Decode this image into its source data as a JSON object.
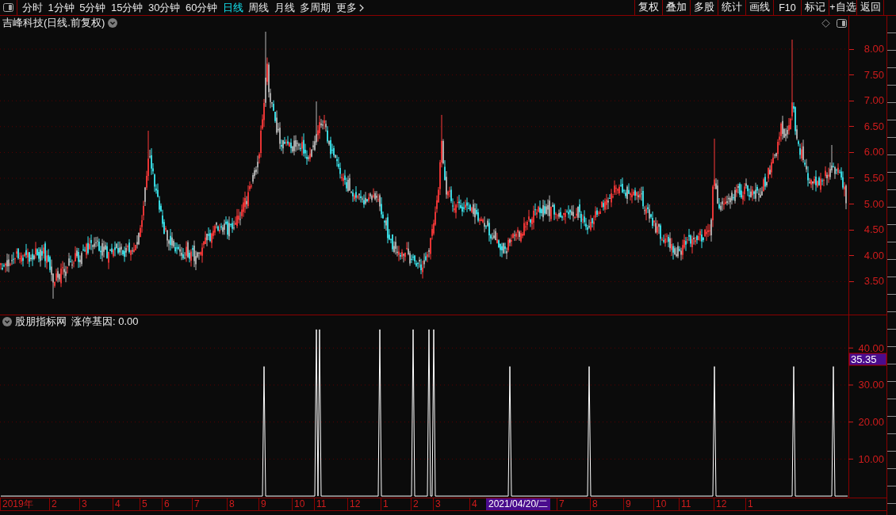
{
  "toolbar": {
    "period_tabs": [
      {
        "label": "分时",
        "selected": false
      },
      {
        "label": "1分钟",
        "selected": false
      },
      {
        "label": "5分钟",
        "selected": false
      },
      {
        "label": "15分钟",
        "selected": false
      },
      {
        "label": "30分钟",
        "selected": false
      },
      {
        "label": "60分钟",
        "selected": false
      },
      {
        "label": "日线",
        "selected": true
      },
      {
        "label": "周线",
        "selected": false
      },
      {
        "label": "月线",
        "selected": false
      },
      {
        "label": "多周期",
        "selected": false
      }
    ],
    "more_button": {
      "label": "更多"
    },
    "buttons": [
      "复权",
      "叠加",
      "多股",
      "统计",
      "画线",
      "F10",
      "标记",
      "+自选",
      "返回"
    ]
  },
  "price_panel": {
    "title": "吉峰科技(日线.前复权)",
    "price_axis": [
      "8.00",
      "7.50",
      "7.00",
      "6.50",
      "6.00",
      "5.50",
      "5.00",
      "4.50",
      "4.00",
      "3.50"
    ]
  },
  "indicator_panel": {
    "name": "股朋指标网",
    "output": "涨停基因: 0.00",
    "cursor_value": "35.35",
    "chart_data": {
      "type": "line",
      "categories": [
        null,
        null,
        null,
        null,
        null,
        null,
        null,
        null,
        null,
        null,
        null,
        null,
        null,
        null,
        null,
        null,
        null,
        null,
        null,
        null,
        null,
        null,
        null,
        null,
        null,
        null,
        null,
        null,
        null,
        null,
        null,
        null,
        null,
        null,
        null,
        null,
        null,
        null,
        null,
        null,
        null,
        null,
        null,
        null,
        null,
        null,
        null,
        null,
        null,
        null,
        null,
        null,
        null,
        null,
        null,
        null,
        null,
        null,
        null,
        null,
        null,
        null,
        null,
        null,
        null,
        null,
        null,
        null,
        null,
        null,
        null,
        null,
        null,
        null,
        null,
        null,
        null,
        null,
        null,
        null,
        null,
        null,
        null,
        null,
        null,
        null,
        null,
        null,
        null,
        null,
        null,
        null,
        null,
        null,
        null,
        null,
        null,
        null,
        null,
        null,
        null,
        null,
        null,
        null,
        null,
        null,
        null,
        null,
        null,
        null,
        null,
        null,
        null,
        null,
        null,
        null,
        null,
        null,
        null,
        null,
        null,
        null,
        null,
        null,
        null,
        null,
        null,
        null,
        null,
        null,
        null,
        null,
        null,
        null,
        null,
        null,
        null,
        null,
        null,
        null,
        null,
        null,
        null,
        null,
        null,
        null,
        null,
        null,
        null,
        null,
        null,
        null,
        null,
        null,
        null,
        null,
        null,
        null,
        null,
        null,
        null,
        null,
        null,
        null,
        null,
        null,
        null,
        null,
        null,
        null,
        null,
        null,
        null,
        null,
        null,
        null,
        null,
        null,
        null,
        null,
        null,
        null,
        null,
        null,
        null,
        null,
        null,
        null,
        null,
        null,
        null,
        null,
        null,
        null,
        null,
        null,
        null,
        null,
        null,
        null,
        null,
        null,
        null,
        null,
        null,
        null,
        null,
        null,
        null,
        null,
        null,
        null,
        null,
        null,
        null,
        null,
        null,
        null,
        null,
        null,
        null,
        null,
        null,
        null,
        null,
        null,
        null,
        null,
        null,
        null,
        null,
        null,
        null,
        null,
        null,
        null,
        null,
        null,
        null,
        null,
        null,
        null,
        null,
        null,
        null,
        null,
        null,
        null,
        null,
        null,
        null,
        null,
        null,
        null,
        null,
        null,
        null,
        null,
        null,
        null,
        null,
        null,
        null,
        null,
        null,
        null,
        null,
        null,
        null,
        null,
        null,
        null,
        null,
        null,
        null,
        null,
        null,
        null,
        null,
        null,
        null,
        null,
        null,
        null,
        null,
        null,
        null,
        null,
        null,
        null,
        null,
        null,
        null,
        null,
        null,
        null,
        null,
        null,
        null,
        null,
        null,
        null,
        null,
        null,
        null,
        null,
        null,
        null,
        null,
        null,
        null,
        null,
        null,
        null,
        null,
        null,
        null,
        null,
        null,
        null,
        null,
        null,
        null,
        null,
        null,
        null,
        null,
        null,
        null,
        null,
        null,
        null,
        null,
        null,
        null,
        null,
        null,
        null,
        null,
        null,
        null,
        null,
        null,
        null,
        null,
        null,
        null,
        null,
        null,
        null,
        null,
        null,
        null,
        null,
        null,
        null,
        null,
        null,
        null,
        null,
        null,
        null,
        null,
        null,
        null,
        null,
        null,
        null,
        null,
        null,
        null,
        null,
        null,
        null,
        null,
        null,
        null,
        null,
        null,
        null,
        null,
        null,
        null,
        null,
        null,
        null,
        null,
        null,
        null,
        null,
        null,
        null,
        null,
        null,
        null,
        null,
        null,
        null,
        null,
        null,
        null,
        null,
        null,
        null,
        null,
        null,
        null,
        null,
        null,
        null,
        null,
        null,
        null,
        null,
        null,
        null,
        null,
        null,
        null,
        null,
        null,
        null,
        null,
        null,
        null,
        null,
        null,
        null,
        null,
        null,
        null,
        null,
        null,
        null,
        null,
        null,
        null,
        null,
        null,
        null,
        null,
        null,
        null,
        null,
        null,
        null,
        null,
        null,
        null,
        null,
        null,
        null,
        null,
        null,
        null,
        null,
        null,
        null,
        null,
        null,
        null,
        null,
        null,
        null,
        null,
        null,
        null,
        null,
        null,
        null,
        null,
        null,
        null,
        null,
        null,
        null,
        null,
        null,
        null,
        null,
        null,
        null,
        null,
        null,
        null,
        null,
        null,
        null,
        null,
        null,
        null,
        null,
        null,
        null,
        null,
        null,
        null,
        null,
        null,
        null,
        null,
        null,
        null,
        null,
        null,
        null,
        null,
        null,
        null,
        null,
        null,
        null,
        null,
        null,
        null,
        null,
        null,
        null,
        null,
        null,
        null,
        null,
        null,
        null,
        null,
        null,
        null,
        null,
        null,
        null,
        null,
        null,
        null,
        null,
        null
      ],
      "series": [
        {
          "color": "#ffffff",
          "values": [
            0,
            0,
            0,
            0,
            0,
            0,
            0,
            0,
            0,
            0,
            0,
            0,
            0,
            0,
            0,
            0,
            0,
            0,
            0,
            0,
            0,
            0,
            0,
            0,
            0,
            0,
            0,
            0,
            0,
            0,
            0,
            0,
            0,
            0,
            0,
            0,
            0,
            0,
            0,
            0,
            0,
            0,
            0,
            0,
            0,
            0,
            0,
            0,
            0,
            0,
            0,
            0,
            0,
            0,
            0,
            0,
            0,
            0,
            0,
            0,
            0,
            0,
            0,
            0,
            0,
            0,
            0,
            0,
            0,
            0,
            0,
            0,
            0,
            0,
            0,
            0,
            0,
            0,
            0,
            0,
            0,
            0,
            0,
            0,
            0,
            0,
            0,
            0,
            0,
            0,
            0,
            0,
            0,
            0,
            0,
            0,
            0,
            0,
            0,
            0,
            0,
            0,
            0,
            0,
            0,
            0,
            0,
            0,
            0,
            0,
            0,
            0,
            0,
            0,
            0,
            0,
            0,
            0,
            0,
            0,
            0,
            0,
            0,
            0,
            0,
            0,
            0,
            0,
            0,
            0,
            0,
            0,
            0,
            0,
            0,
            0,
            0,
            0,
            0,
            0,
            0,
            0,
            0,
            0,
            0,
            0,
            0,
            0,
            0,
            0,
            0,
            0,
            0,
            0,
            0,
            0,
            0,
            0,
            0,
            0,
            0,
            0,
            0,
            0,
            0,
            0,
            35,
            0,
            0,
            0,
            0,
            0,
            0,
            0,
            0,
            0,
            0,
            0,
            0,
            0,
            0,
            0,
            0,
            0,
            0,
            0,
            0,
            0,
            0,
            0,
            0,
            0,
            0,
            0,
            0,
            0,
            0,
            0,
            0,
            45,
            0,
            45,
            0,
            0,
            0,
            0,
            0,
            0,
            0,
            0,
            0,
            0,
            0,
            0,
            0,
            0,
            0,
            0,
            0,
            0,
            0,
            0,
            0,
            0,
            0,
            0,
            0,
            0,
            0,
            0,
            0,
            0,
            0,
            0,
            0,
            0,
            0,
            0,
            0,
            45,
            0,
            0,
            0,
            0,
            0,
            0,
            0,
            0,
            0,
            0,
            0,
            0,
            0,
            0,
            0,
            0,
            0,
            0,
            0,
            0,
            45,
            0,
            0,
            0,
            0,
            0,
            0,
            0,
            0,
            0,
            45,
            0,
            0,
            45,
            0,
            0,
            0,
            0,
            0,
            0,
            0,
            0,
            0,
            0,
            0,
            0,
            0,
            0,
            0,
            0,
            0,
            0,
            0,
            0,
            0,
            0,
            0,
            0,
            0,
            0,
            0,
            0,
            0,
            0,
            0,
            0,
            0,
            0,
            0,
            0,
            0,
            0,
            0,
            0,
            0,
            0,
            0,
            0,
            0,
            0,
            0,
            35,
            0,
            0,
            0,
            0,
            0,
            0,
            0,
            0,
            0,
            0,
            0,
            0,
            0,
            0,
            0,
            0,
            0,
            0,
            0,
            0,
            0,
            0,
            0,
            0,
            0,
            0,
            0,
            0,
            0,
            0,
            0,
            0,
            0,
            0,
            0,
            0,
            0,
            0,
            0,
            0,
            0,
            0,
            0,
            0,
            0,
            0,
            0,
            0,
            0,
            35,
            0,
            0,
            0,
            0,
            0,
            0,
            0,
            0,
            0,
            0,
            0,
            0,
            0,
            0,
            0,
            0,
            0,
            0,
            0,
            0,
            0,
            0,
            0,
            0,
            0,
            0,
            0,
            0,
            0,
            0,
            0,
            0,
            0,
            0,
            0,
            0,
            0,
            0,
            0,
            0,
            0,
            0,
            0,
            0,
            0,
            0,
            0,
            0,
            0,
            0,
            0,
            0,
            0,
            0,
            0,
            0,
            0,
            0,
            0,
            0,
            0,
            0,
            0,
            0,
            0,
            0,
            0,
            0,
            0,
            0,
            0,
            0,
            0,
            0,
            0,
            0,
            0,
            0,
            35,
            0,
            0,
            0,
            0,
            0,
            0,
            0,
            0,
            0,
            0,
            0,
            0,
            0,
            0,
            0,
            0,
            0,
            0,
            0,
            0,
            0,
            0,
            0,
            0,
            0,
            0,
            0,
            0,
            0,
            0,
            0,
            0,
            0,
            0,
            0,
            0,
            0,
            0,
            0,
            0,
            0,
            0,
            0,
            0,
            0,
            0,
            0,
            0,
            0,
            35,
            0,
            0,
            0,
            0,
            0,
            0,
            0,
            0,
            0,
            0,
            0,
            0,
            0,
            0,
            0,
            0,
            0,
            0,
            0,
            0,
            0,
            0,
            0,
            0,
            35,
            0,
            0,
            0,
            0,
            0,
            0,
            0,
            0,
            0
          ]
        }
      ],
      "ylim": [
        -0.4,
        45.4
      ],
      "yticks": [
        {
          "value": 10,
          "label": "10.00"
        },
        {
          "value": 20,
          "label": "20.00"
        },
        {
          "value": 30,
          "label": "30.00"
        },
        {
          "value": 40,
          "label": "40.00"
        }
      ],
      "grid": true
    }
  },
  "date_axis": [
    {
      "kind": "tick",
      "label": "2019年"
    },
    {
      "kind": "tick",
      "label": "2"
    },
    {
      "kind": "tick",
      "label": "3"
    },
    {
      "kind": "tick",
      "label": "4"
    },
    {
      "kind": "tick",
      "label": "5"
    },
    {
      "kind": "tick",
      "label": "6"
    },
    {
      "kind": "tick",
      "label": "7"
    },
    {
      "kind": "tick",
      "label": "8"
    },
    {
      "kind": "tick",
      "label": "9"
    },
    {
      "kind": "tick",
      "label": "10"
    },
    {
      "kind": "tick",
      "label": "11"
    },
    {
      "kind": "tick",
      "label": "12"
    },
    {
      "kind": "tick",
      "label": "1"
    },
    {
      "kind": "tick",
      "label": "2"
    },
    {
      "kind": "tick",
      "label": "3"
    },
    {
      "kind": "tick",
      "label": "4"
    },
    {
      "kind": "cursor",
      "label": "2021/04/20/二"
    },
    {
      "kind": "tick",
      "label": "7"
    },
    {
      "kind": "tick",
      "label": "8"
    },
    {
      "kind": "tick",
      "label": "9"
    },
    {
      "kind": "tick",
      "label": "10"
    },
    {
      "kind": "tick",
      "label": "11"
    },
    {
      "kind": "tick",
      "label": "12"
    },
    {
      "kind": "tick",
      "label": "1"
    }
  ]
}
